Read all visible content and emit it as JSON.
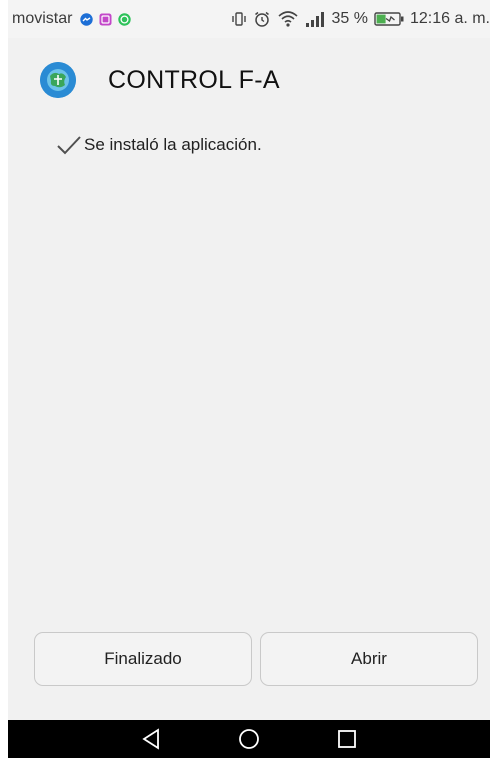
{
  "status_bar": {
    "carrier": "movistar",
    "battery_percent": "35 %",
    "time": "12:16 a. m."
  },
  "app": {
    "title": "CONTROL F-A"
  },
  "message": {
    "text": "Se instaló la aplicación."
  },
  "buttons": {
    "done_label": "Finalizado",
    "open_label": "Abrir"
  },
  "colors": {
    "app_icon": "#2a8bd4",
    "battery_fill": "#4caf50",
    "screen_background": "#f1f1f1",
    "nav_bar": "#000000"
  },
  "icons": {
    "notifications": [
      "messenger-icon",
      "gallery-icon",
      "whatsapp-icon"
    ],
    "status": [
      "vibrate-icon",
      "alarm-icon",
      "wifi-icon",
      "signal-icon",
      "battery-icon"
    ],
    "navigation": [
      "back-icon",
      "home-icon",
      "recents-icon"
    ]
  }
}
